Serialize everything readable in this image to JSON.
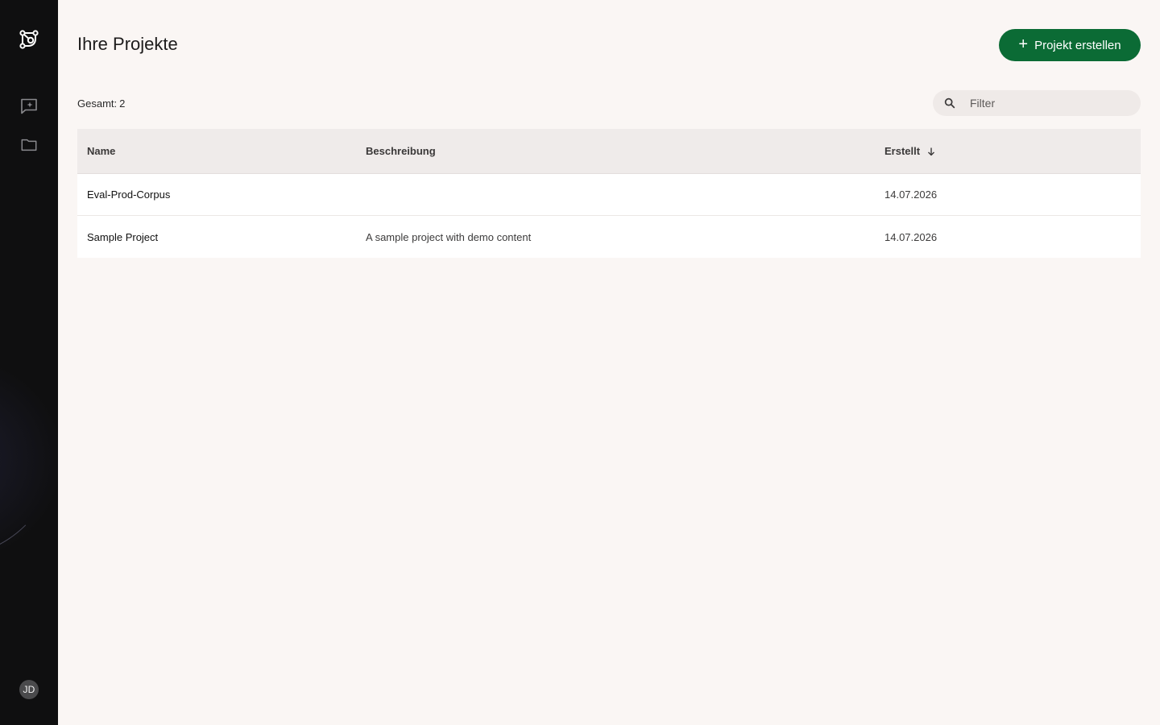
{
  "app": {
    "title": "Ihre Projekte"
  },
  "sidebar": {
    "logo_icon": "graph-logo-icon",
    "items": [
      {
        "name": "chat",
        "icon": "chat-sparkle-icon"
      },
      {
        "name": "projects",
        "icon": "folder-icon"
      }
    ],
    "user_initials": "JD"
  },
  "header": {
    "title": "Ihre Projekte",
    "create_button_label": "Projekt erstellen",
    "accent_color": "#0b6b35"
  },
  "toolbar": {
    "total_label": "Gesamt:",
    "total_count": "2",
    "filter_placeholder": "Filter",
    "filter_value": ""
  },
  "table": {
    "columns": [
      "Name",
      "Beschreibung",
      "Erstellt"
    ],
    "sort_column": "Erstellt",
    "sort_direction": "descending",
    "rows": [
      {
        "name": "Eval-Prod-Corpus",
        "description": "",
        "created": "14.07.2026"
      },
      {
        "name": "Sample Project",
        "description": "A sample project with demo content",
        "created": "14.07.2026"
      }
    ]
  }
}
